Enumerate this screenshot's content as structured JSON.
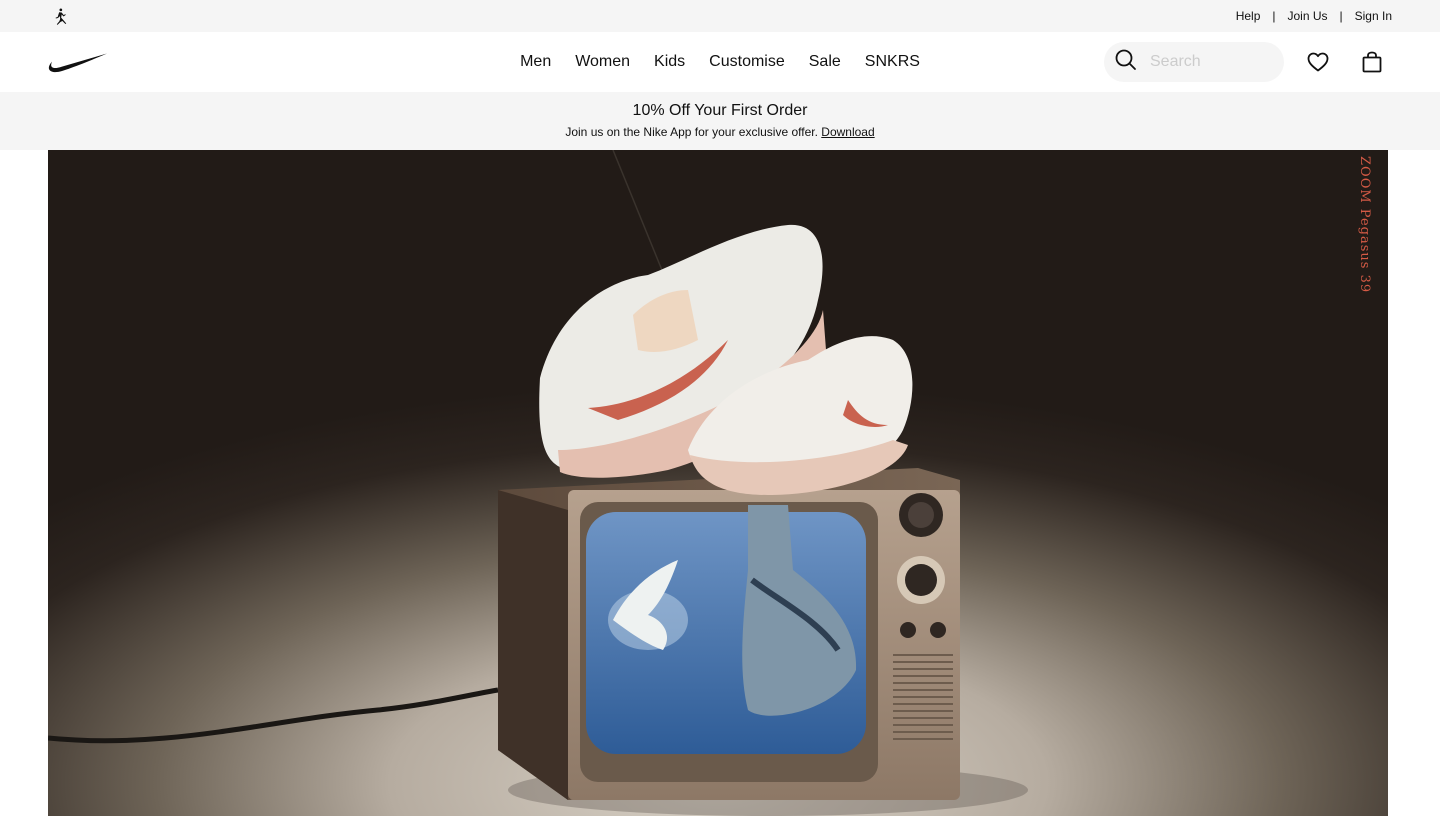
{
  "utility": {
    "logo_icon": "jordan-jumpman-icon",
    "links": [
      {
        "label": "Help"
      },
      {
        "label": "Join Us"
      },
      {
        "label": "Sign In"
      }
    ],
    "separator": "|"
  },
  "nav": {
    "logo_icon": "nike-swoosh-icon",
    "links": [
      {
        "label": "Men"
      },
      {
        "label": "Women"
      },
      {
        "label": "Kids"
      },
      {
        "label": "Customise"
      },
      {
        "label": "Sale"
      },
      {
        "label": "SNKRS"
      }
    ],
    "search": {
      "placeholder": "Search",
      "icon": "search-icon"
    },
    "favorites_icon": "heart-icon",
    "bag_icon": "bag-icon"
  },
  "promo": {
    "title": "10% Off Your First Order",
    "subtitle": "Join us on the Nike App for your exclusive offer.",
    "link": "Download"
  },
  "hero": {
    "vertical_brand": "ZOOM Pegasus 39",
    "accent_color": "#d45a45"
  }
}
